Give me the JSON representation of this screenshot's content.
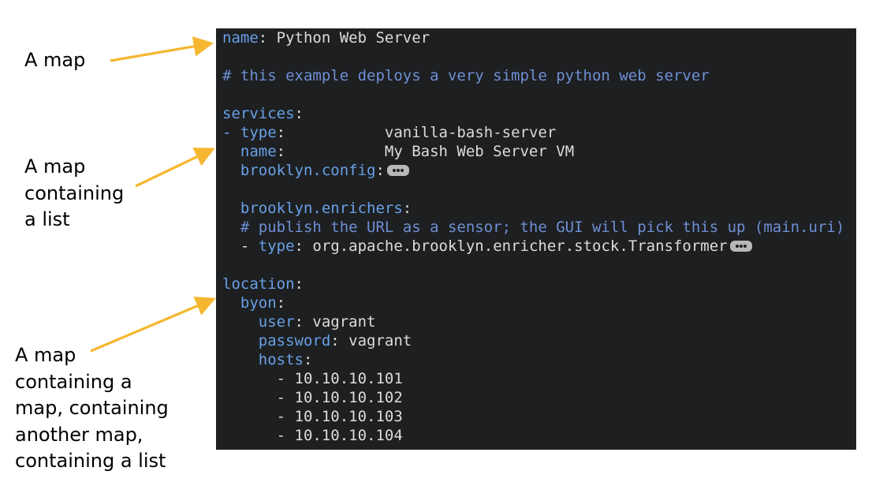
{
  "annotations": [
    {
      "lines": [
        "A map"
      ]
    },
    {
      "lines": [
        "A map",
        "containing",
        "a list"
      ]
    },
    {
      "lines": [
        "A map",
        "containing a",
        "map, containing",
        "another map,",
        "containing a list"
      ]
    }
  ],
  "code_lines": [
    [
      {
        "t": "name",
        "c": "k"
      },
      {
        "t": ": Python Web Server",
        "c": "v"
      }
    ],
    [],
    [
      {
        "t": "# this example deploys a very simple python web server",
        "c": "c"
      }
    ],
    [],
    [
      {
        "t": "services",
        "c": "k"
      },
      {
        "t": ":",
        "c": "v"
      }
    ],
    [
      {
        "t": "- ",
        "c": "k"
      },
      {
        "t": "type",
        "c": "k"
      },
      {
        "t": ":           vanilla-bash-server",
        "c": "v"
      }
    ],
    [
      {
        "t": "  name",
        "c": "k"
      },
      {
        "t": ":           My Bash Web Server VM",
        "c": "v"
      }
    ],
    [
      {
        "t": "  brooklyn.config",
        "c": "k"
      },
      {
        "t": ":",
        "c": "v"
      },
      {
        "fold": true
      }
    ],
    [],
    [
      {
        "t": "  brooklyn.enrichers",
        "c": "k"
      },
      {
        "t": ":",
        "c": "v"
      }
    ],
    [
      {
        "t": "  # publish the URL as a sensor; the GUI will pick this up (main.uri)",
        "c": "c"
      }
    ],
    [
      {
        "t": "  - ",
        "c": "v"
      },
      {
        "t": "type",
        "c": "k"
      },
      {
        "t": ": org.apache.brooklyn.enricher.stock.Transformer",
        "c": "v"
      },
      {
        "fold": true
      }
    ],
    [],
    [
      {
        "t": "location",
        "c": "k"
      },
      {
        "t": ":",
        "c": "v"
      }
    ],
    [
      {
        "t": "  byon",
        "c": "k"
      },
      {
        "t": ":",
        "c": "v"
      }
    ],
    [
      {
        "t": "    user",
        "c": "k"
      },
      {
        "t": ": vagrant",
        "c": "v"
      }
    ],
    [
      {
        "t": "    password",
        "c": "k"
      },
      {
        "t": ": vagrant",
        "c": "v"
      }
    ],
    [
      {
        "t": "    hosts",
        "c": "k"
      },
      {
        "t": ":",
        "c": "v"
      }
    ],
    [
      {
        "t": "      - 10.10.10.101",
        "c": "v"
      }
    ],
    [
      {
        "t": "      - 10.10.10.102",
        "c": "v"
      }
    ],
    [
      {
        "t": "      - 10.10.10.103",
        "c": "v"
      }
    ],
    [
      {
        "t": "      - 10.10.10.104",
        "c": "v"
      }
    ]
  ],
  "colors": {
    "arrow": "#f5b731",
    "editor_bg": "#1d1f21",
    "key": "#69a0e6",
    "comment": "#6f8fd4",
    "text": "#dcdcdc"
  }
}
